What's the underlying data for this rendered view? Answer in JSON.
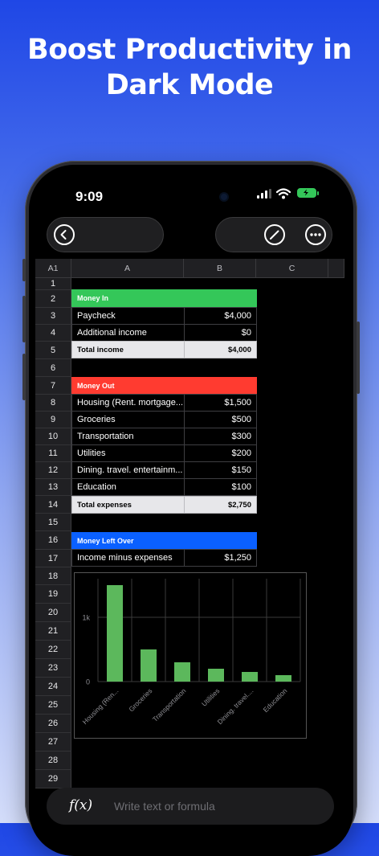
{
  "headline": "Boost Productivity in Dark Mode",
  "status": {
    "time": "9:09",
    "battery_color": "#34c759"
  },
  "toolbar": {
    "back_icon": "chevron-left-icon",
    "edit_icon": "pencil-icon",
    "more_icon": "ellipsis-icon"
  },
  "sheet": {
    "cell_ref": "A1",
    "columns": [
      "A",
      "B",
      "C"
    ],
    "rows": [
      "1",
      "2",
      "3",
      "4",
      "5",
      "6",
      "7",
      "8",
      "9",
      "10",
      "11",
      "12",
      "13",
      "14",
      "15",
      "16",
      "17",
      "18",
      "19",
      "20",
      "21",
      "22",
      "23",
      "24",
      "25",
      "26",
      "27",
      "28",
      "29"
    ],
    "money_in": {
      "header": "Money In",
      "color": "#34c759"
    },
    "income": [
      {
        "label": "Paycheck",
        "value": "$4,000"
      },
      {
        "label": "Additional income",
        "value": "$0"
      }
    ],
    "total_income": {
      "label": "Total income",
      "value": "$4,000"
    },
    "money_out": {
      "header": "Money Out",
      "color": "#ff3b30"
    },
    "expenses": [
      {
        "label": "Housing (Rent. mortgage....",
        "value": "$1,500"
      },
      {
        "label": "Groceries",
        "value": "$500"
      },
      {
        "label": "Transportation",
        "value": "$300"
      },
      {
        "label": "Utilities",
        "value": "$200"
      },
      {
        "label": "Dining. travel. entertainm...",
        "value": "$150"
      },
      {
        "label": "Education",
        "value": "$100"
      }
    ],
    "total_expenses": {
      "label": "Total expenses",
      "value": "$2,750"
    },
    "left_over": {
      "header": "Money Left Over",
      "color": "#0a60ff"
    },
    "income_minus": {
      "label": "Income minus expenses",
      "value": "$1,250"
    }
  },
  "chart_data": {
    "type": "bar",
    "categories": [
      "Housing (Ren...",
      "Groceries",
      "Transportation",
      "Utilities",
      "Dining. travel....",
      "Education"
    ],
    "values": [
      1500,
      500,
      300,
      200,
      150,
      100
    ],
    "ytick_labels": [
      "0",
      "1k"
    ],
    "ylim": [
      0,
      1600
    ],
    "bar_color": "#5cb85c",
    "grid": true
  },
  "formula": {
    "icon": "f(x)",
    "placeholder": "Write text or formula"
  }
}
